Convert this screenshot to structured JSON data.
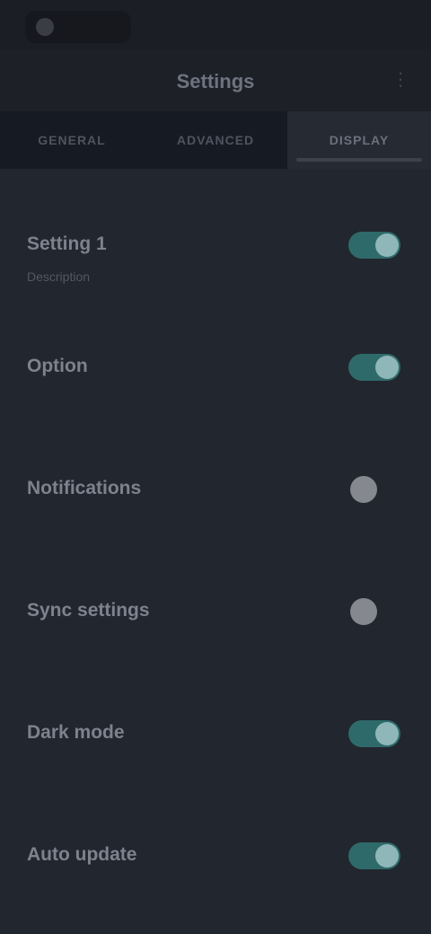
{
  "status_bar": {
    "time": "",
    "pill_label": ""
  },
  "app_bar": {
    "title": "Settings",
    "menu_icon": "more-vert-icon"
  },
  "tabs": [
    {
      "label": "GENERAL",
      "active": false
    },
    {
      "label": "ADVANCED",
      "active": false
    },
    {
      "label": "DISPLAY",
      "active": true
    }
  ],
  "settings": [
    {
      "title": "Setting 1",
      "subtitle": "Description",
      "enabled": true
    },
    {
      "title": "Option",
      "subtitle": "",
      "enabled": true
    },
    {
      "title": "Notifications",
      "subtitle": "",
      "enabled": false
    },
    {
      "title": "Sync settings",
      "subtitle": "",
      "enabled": false
    },
    {
      "title": "Dark mode",
      "subtitle": "",
      "enabled": true
    },
    {
      "title": "Auto update",
      "subtitle": "",
      "enabled": true
    }
  ],
  "colors": {
    "background": "#22262e",
    "toggle_on": "#2f6a6a",
    "toggle_knob_on": "#8fb6b8",
    "toggle_knob_off": "#85888f"
  }
}
